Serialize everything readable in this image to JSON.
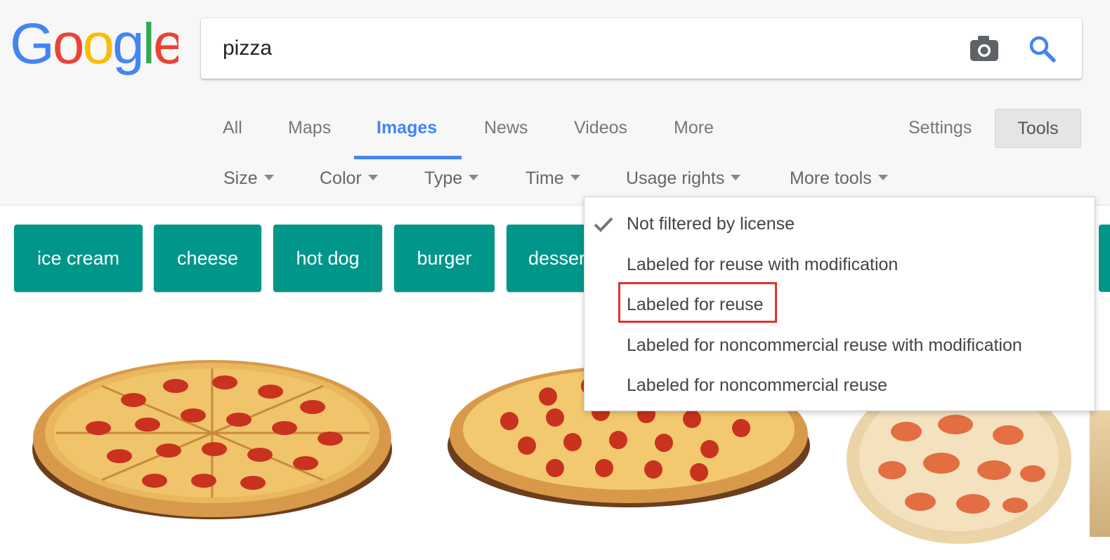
{
  "logo": {
    "text": "Google"
  },
  "search": {
    "query": "pizza"
  },
  "tabs": [
    {
      "label": "All"
    },
    {
      "label": "Maps"
    },
    {
      "label": "Images"
    },
    {
      "label": "News"
    },
    {
      "label": "Videos"
    },
    {
      "label": "More"
    }
  ],
  "header": {
    "settings_label": "Settings",
    "tools_label": "Tools"
  },
  "filters": [
    {
      "label": "Size"
    },
    {
      "label": "Color"
    },
    {
      "label": "Type"
    },
    {
      "label": "Time"
    },
    {
      "label": "Usage rights"
    },
    {
      "label": "More tools"
    }
  ],
  "chips": [
    {
      "label": "ice cream"
    },
    {
      "label": "cheese"
    },
    {
      "label": "hot dog"
    },
    {
      "label": "burger"
    },
    {
      "label": "dessert"
    }
  ],
  "usage_rights_menu": {
    "items": [
      {
        "label": "Not filtered by license",
        "checked": true
      },
      {
        "label": "Labeled for reuse with modification",
        "checked": false
      },
      {
        "label": "Labeled for reuse",
        "checked": false,
        "highlighted": true
      },
      {
        "label": "Labeled for noncommercial reuse with modification",
        "checked": false
      },
      {
        "label": "Labeled for noncommercial reuse",
        "checked": false
      }
    ]
  },
  "colors": {
    "accent_blue": "#4285f4",
    "chip_teal": "#00968a",
    "highlight_red": "#e0322f"
  },
  "icons": [
    "camera-icon",
    "search-icon",
    "check-icon",
    "caret-down-icon"
  ]
}
